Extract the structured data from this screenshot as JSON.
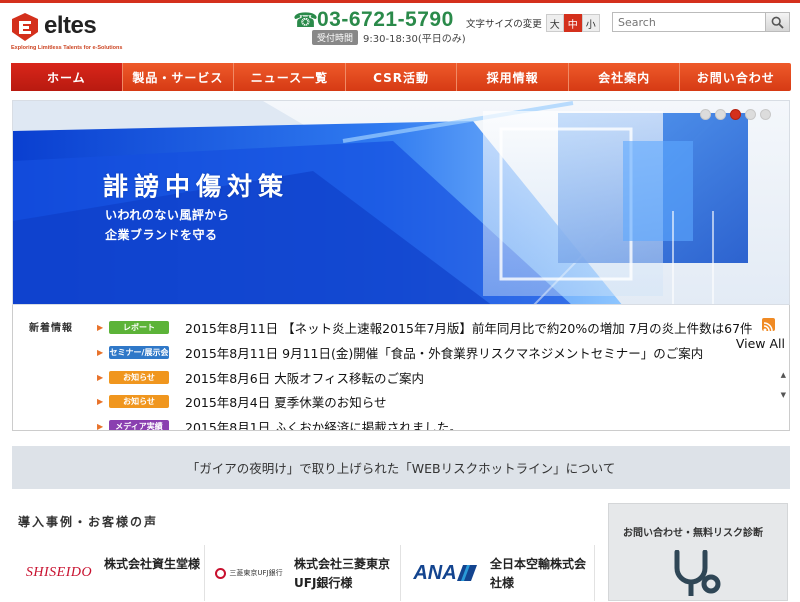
{
  "header": {
    "logo_text": "eltes",
    "logo_tagline": "Exploring Limitless Talents for e-Solutions",
    "phone": "03-6721-5790",
    "hours_label": "受付時間",
    "hours_time": "9:30-18:30(平日のみ)",
    "fontsize_label": "文字サイズの変更",
    "fontsize_options": [
      "大",
      "中",
      "小"
    ],
    "fontsize_selected": "中",
    "search_placeholder": "Search"
  },
  "nav": {
    "items": [
      "ホーム",
      "製品・サービス",
      "ニュース一覧",
      "CSR活動",
      "採用情報",
      "会社案内",
      "お問い合わせ"
    ],
    "active": "ホーム"
  },
  "hero": {
    "title": "誹謗中傷対策",
    "subtitle_line1": "いわれのない風評から",
    "subtitle_line2": "企業ブランドを守る",
    "slide_count": 5,
    "active_slide": 4
  },
  "news": {
    "heading": "新着情報",
    "view_all": "View All",
    "items": [
      {
        "badge": "レポート",
        "badge_color": "#5cb338",
        "text": "2015年8月11日 【ネット炎上速報2015年7月版】前年同月比で約20%の増加 7月の炎上件数は67件"
      },
      {
        "badge": "セミナー/展示会",
        "badge_color": "#2f78c8",
        "text": "2015年8月11日 9月11日(金)開催「食品・外食業界リスクマネジメントセミナー」のご案内"
      },
      {
        "badge": "お知らせ",
        "badge_color": "#f0961e",
        "text": "2015年8月6日 大阪オフィス移転のご案内"
      },
      {
        "badge": "お知らせ",
        "badge_color": "#f0961e",
        "text": "2015年8月4日 夏季休業のお知らせ"
      },
      {
        "badge": "メディア実績",
        "badge_color": "#8a3fb0",
        "text": "2015年8月1日 ふくおか経済に掲載されました。"
      }
    ]
  },
  "banner": {
    "text": "「ガイアの夜明け」で取り上げられた「WEBリスクホットライン」について"
  },
  "cases": {
    "title": "導入事例・お客様の声",
    "items": [
      {
        "logo": "SHISEIDO",
        "name_line1": "株式会社資生堂様",
        "name_line2": ""
      },
      {
        "logo": "三菱東京UFJ銀行",
        "name_line1": "株式会社三菱東京",
        "name_line2": "UFJ銀行様"
      },
      {
        "logo": "ANA",
        "name_line1": "全日本空輸株式会",
        "name_line2": "社様"
      }
    ]
  },
  "contact_box": {
    "title": "お問い合わせ・無料リスク診断"
  },
  "colors": {
    "brand_red": "#d4301c",
    "phone_green": "#2a8a4a"
  }
}
